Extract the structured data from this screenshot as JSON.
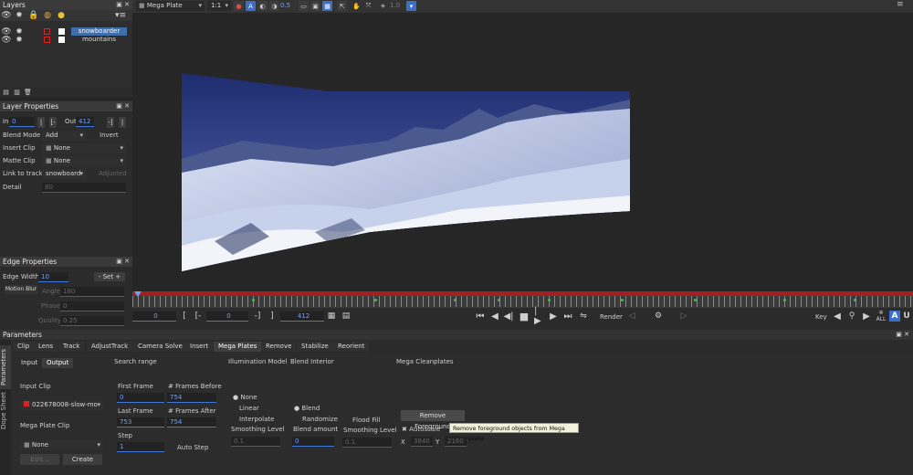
{
  "toolbar": {
    "clip_selector": "Mega Plate",
    "zoom": "1:1",
    "opacity_value": "0.5",
    "brightness_value": "1.0"
  },
  "layers": {
    "title": "Layers",
    "rows": [
      {
        "name": "snowboarder",
        "selected": true
      },
      {
        "name": "mountains",
        "selected": false
      }
    ]
  },
  "layer_properties": {
    "title": "Layer Properties",
    "in_label": "In",
    "in_value": "0",
    "out_label": "Out",
    "out_value": "412",
    "blend_mode_label": "Blend Mode",
    "blend_mode_value": "Add",
    "invert_label": "Invert",
    "insert_clip_label": "Insert Clip",
    "insert_clip_value": "None",
    "matte_clip_label": "Matte Clip",
    "matte_clip_value": "None",
    "link_label": "Link to track",
    "link_value": "snowboard",
    "adjusted_label": "Adjusted",
    "detail_label": "Detail",
    "detail_value": "80"
  },
  "edge_properties": {
    "title": "Edge Properties",
    "edge_width_label": "Edge Width",
    "edge_width_value": "10",
    "set_label": "Set",
    "motion_blur_label": "Motion Blur",
    "angle_label": "Angle",
    "angle_value": "180",
    "phase_label": "Phase",
    "phase_value": "0",
    "quality_label": "Quality",
    "quality_value": "0.25"
  },
  "timeline": {
    "start_value": "0",
    "in_value": "0",
    "current_frame": "412",
    "render_label": "Render",
    "key_label": "Key",
    "all_label": "ALL",
    "a_label": "A",
    "u_label": "U"
  },
  "parameters": {
    "title": "Parameters",
    "side_tabs": [
      "Parameters",
      "Dope Sheet"
    ],
    "tabs": [
      "Clip",
      "Lens",
      "Track",
      "AdjustTrack",
      "Camera Solve",
      "Insert",
      "Mega Plates",
      "Remove",
      "Stabilize",
      "Reorient"
    ],
    "active_tab": "Mega Plates",
    "sub_tabs": [
      "Input",
      "Output"
    ],
    "input_clip_label": "Input Clip",
    "input_clip_value": "022678008-slow-mo",
    "mega_plate_clip_label": "Mega Plate Clip",
    "mega_plate_clip_value": "None",
    "edit_label": "Edit...",
    "create_label": "Create",
    "search_range_label": "Search range",
    "first_frame_label": "First Frame",
    "first_frame_value": "0",
    "frames_before_label": "# Frames Before",
    "frames_before_value": "754",
    "last_frame_label": "Last Frame",
    "last_frame_value": "753",
    "frames_after_label": "# Frames After",
    "frames_after_value": "754",
    "step_label": "Step",
    "step_value": "1",
    "auto_step_label": "Auto Step",
    "illumination_label": "Illumination Model",
    "illum_options": [
      "None",
      "Linear",
      "Interpolate"
    ],
    "smoothing_level_label": "Smoothing Level",
    "smoothing_level_value": "0.1",
    "blend_interior_label": "Blend Interior",
    "blend_options": [
      "Blend",
      "Randomize"
    ],
    "blend_amount_label": "Blend amount",
    "blend_amount_value": "0",
    "flood_fill_label": "Flood Fill",
    "smoothing_level2_label": "Smoothing Level",
    "smoothing_level2_value": "0.1",
    "mega_cleanplates_label": "Mega Cleanplates",
    "remove_fg_label": "Remove Foreground",
    "autoscale_label": "Autoscale",
    "tooltip": "Remove foreground objects from Mega Cleanplate",
    "x_label": "X",
    "x_value": "3840",
    "y_label": "Y",
    "y_value": "2160"
  }
}
